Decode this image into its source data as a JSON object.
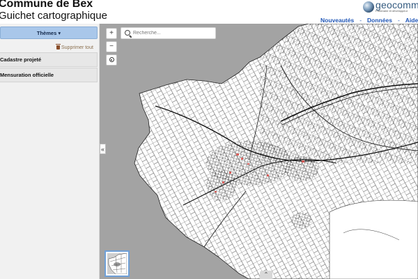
{
  "header": {
    "title": "Commune de Bex",
    "subtitle": "Guichet cartographique",
    "logo": {
      "name": "geocommunes",
      "text": "geocomm",
      "tagline": "Partenaire et développeur"
    },
    "nav": [
      "Nouveautés",
      "Données",
      "Aide"
    ],
    "nav_separator": "-"
  },
  "sidebar": {
    "themes_button": "Thèmes ▾",
    "delete_all": "Supprimer tout",
    "items": [
      {
        "label": "Cadastre projeté"
      },
      {
        "label": "Mensuration officielle"
      }
    ],
    "collapse_glyph": "«"
  },
  "map": {
    "search_placeholder": "Recherche...",
    "zoom_in": "+",
    "zoom_out": "−",
    "expand_glyph": "⌃"
  },
  "colors": {
    "background_outside": "#a3a3a3",
    "map_land": "#ffffff",
    "parcel_lines": "#1a1a1a",
    "highlight": "#d9534f",
    "themes_button": "#a9c7ea",
    "nav_link": "#2157b7"
  },
  "icons": [
    "trash-icon",
    "search-icon",
    "locate-icon",
    "chevron-left-icon",
    "chevron-up-icon"
  ]
}
